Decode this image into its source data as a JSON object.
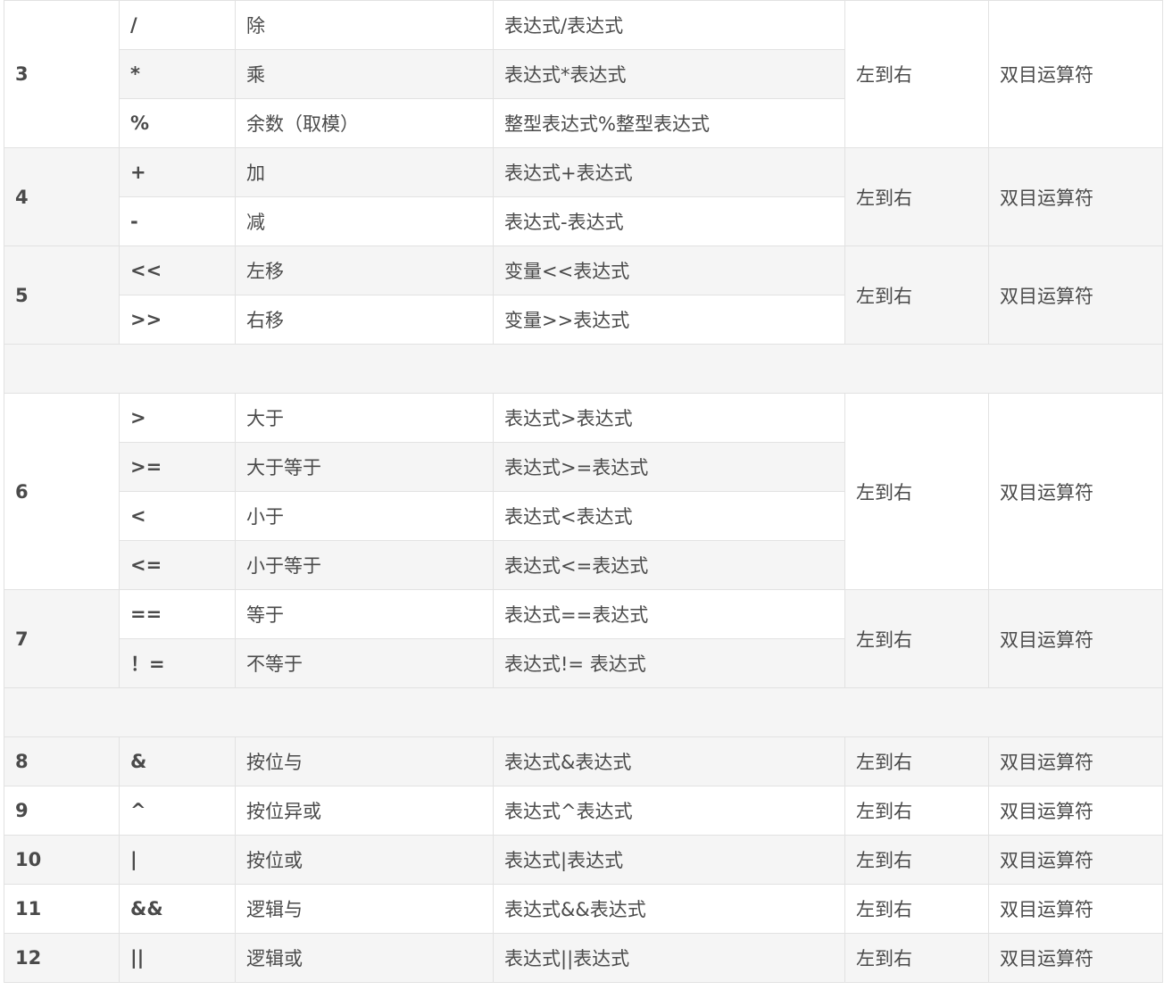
{
  "groups": [
    {
      "level": "3",
      "bg": "w",
      "operators": [
        {
          "symbol": "/",
          "name": "除",
          "usage": "表达式/表达式",
          "bg": "w"
        },
        {
          "symbol": "*",
          "name": "乘",
          "usage": "表达式*表达式",
          "bg": "g"
        },
        {
          "symbol": "%",
          "name": "余数（取模）",
          "usage": "整型表达式%整型表达式",
          "bg": "w"
        }
      ],
      "associativity": "左到右",
      "type": "双目运算符"
    },
    {
      "level": "4",
      "bg": "g",
      "operators": [
        {
          "symbol": "+",
          "name": "加",
          "usage": "表达式+表达式",
          "bg": "g"
        },
        {
          "symbol": "-",
          "name": "减",
          "usage": "表达式-表达式",
          "bg": "w"
        }
      ],
      "associativity": "左到右",
      "type": "双目运算符"
    },
    {
      "level": "5",
      "bg": "g",
      "operators": [
        {
          "symbol": "<<",
          "name": "左移",
          "usage": "变量<<表达式",
          "bg": "g"
        },
        {
          "symbol": ">>",
          "name": "右移",
          "usage": "变量>>表达式",
          "bg": "w"
        }
      ],
      "associativity": "左到右",
      "type": "双目运算符"
    },
    {
      "spacer": true
    },
    {
      "level": "6",
      "bg": "w",
      "operators": [
        {
          "symbol": ">",
          "name": "大于",
          "usage": "表达式>表达式",
          "bg": "w"
        },
        {
          "symbol": ">=",
          "name": "大于等于",
          "usage": "表达式>=表达式",
          "bg": "g"
        },
        {
          "symbol": "<",
          "name": "小于",
          "usage": "表达式<表达式",
          "bg": "w"
        },
        {
          "symbol": "<=",
          "name": "小于等于",
          "usage": "表达式<=表达式",
          "bg": "g"
        }
      ],
      "associativity": "左到右",
      "type": "双目运算符"
    },
    {
      "level": "7",
      "bg": "g",
      "operators": [
        {
          "symbol": "==",
          "name": "等于",
          "usage": "表达式==表达式",
          "bg": "w"
        },
        {
          "symbol": "！=",
          "name": "不等于",
          "usage": "表达式!= 表达式",
          "bg": "g"
        }
      ],
      "associativity": "左到右",
      "type": "双目运算符"
    },
    {
      "spacer": true,
      "bg": "w"
    },
    {
      "level": "8",
      "bg": "g",
      "operators": [
        {
          "symbol": "&",
          "name": "按位与",
          "usage": "表达式&表达式",
          "bg": "g"
        }
      ],
      "associativity": "左到右",
      "type": "双目运算符"
    },
    {
      "level": "9",
      "bg": "w",
      "operators": [
        {
          "symbol": "^",
          "name": "按位异或",
          "usage": "表达式^表达式",
          "bg": "w"
        }
      ],
      "associativity": "左到右",
      "type": "双目运算符"
    },
    {
      "level": "10",
      "bg": "g",
      "operators": [
        {
          "symbol": "|",
          "name": "按位或",
          "usage": "表达式|表达式",
          "bg": "g"
        }
      ],
      "associativity": "左到右",
      "type": "双目运算符"
    },
    {
      "level": "11",
      "bg": "w",
      "operators": [
        {
          "symbol": "&&",
          "name": "逻辑与",
          "usage": "表达式&&表达式",
          "bg": "w"
        }
      ],
      "associativity": "左到右",
      "type": "双目运算符"
    },
    {
      "level": "12",
      "bg": "g",
      "operators": [
        {
          "symbol": "||",
          "name": "逻辑或",
          "usage": "表达式||表达式",
          "bg": "g"
        }
      ],
      "associativity": "左到右",
      "type": "双目运算符"
    }
  ]
}
